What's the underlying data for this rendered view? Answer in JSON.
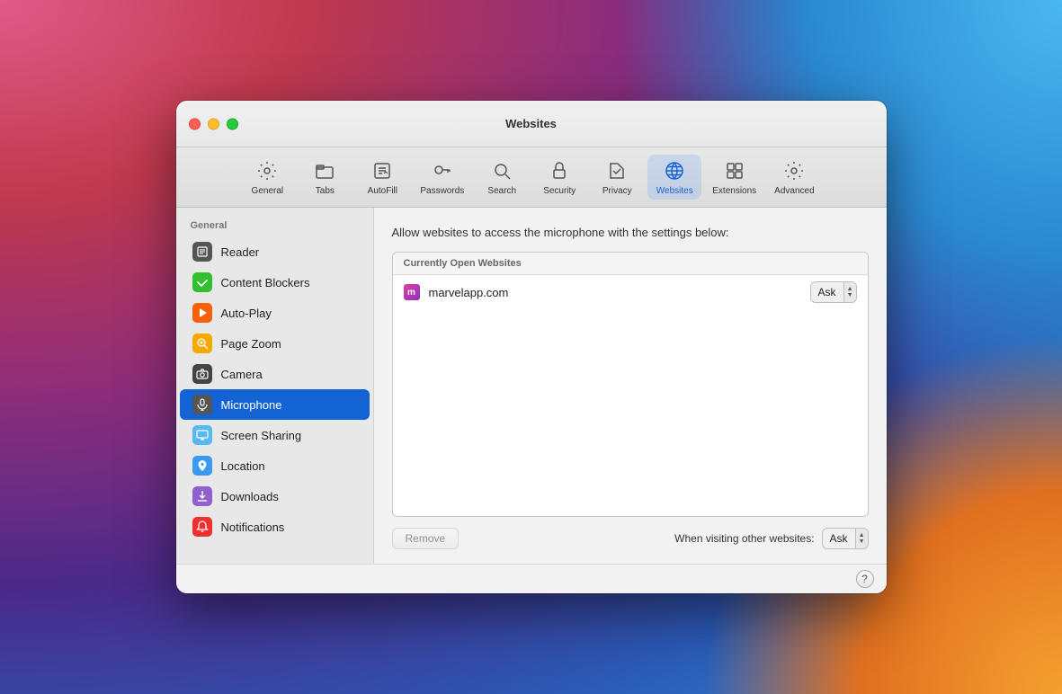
{
  "window": {
    "title": "Websites"
  },
  "trafficLights": {
    "close": "close",
    "minimize": "minimize",
    "maximize": "maximize"
  },
  "toolbar": {
    "items": [
      {
        "id": "general",
        "label": "General",
        "icon": "⚙️"
      },
      {
        "id": "tabs",
        "label": "Tabs",
        "icon": "⬜"
      },
      {
        "id": "autofill",
        "label": "AutoFill",
        "icon": "✏️"
      },
      {
        "id": "passwords",
        "label": "Passwords",
        "icon": "🔑"
      },
      {
        "id": "search",
        "label": "Search",
        "icon": "🔍"
      },
      {
        "id": "security",
        "label": "Security",
        "icon": "🔒"
      },
      {
        "id": "privacy",
        "label": "Privacy",
        "icon": "✋"
      },
      {
        "id": "websites",
        "label": "Websites",
        "icon": "🌐",
        "active": true
      },
      {
        "id": "extensions",
        "label": "Extensions",
        "icon": "🧩"
      },
      {
        "id": "advanced",
        "label": "Advanced",
        "icon": "⚙️"
      }
    ]
  },
  "sidebar": {
    "group_label": "General",
    "items": [
      {
        "id": "reader",
        "label": "Reader",
        "icon": "📄",
        "iconClass": "icon-reader",
        "active": false
      },
      {
        "id": "content-blockers",
        "label": "Content Blockers",
        "icon": "✓",
        "iconClass": "icon-content-blockers",
        "active": false
      },
      {
        "id": "auto-play",
        "label": "Auto-Play",
        "icon": "▶",
        "iconClass": "icon-autoplay",
        "active": false
      },
      {
        "id": "page-zoom",
        "label": "Page Zoom",
        "icon": "🔍",
        "iconClass": "icon-page-zoom",
        "active": false
      },
      {
        "id": "camera",
        "label": "Camera",
        "icon": "📷",
        "iconClass": "icon-camera",
        "active": false
      },
      {
        "id": "microphone",
        "label": "Microphone",
        "icon": "🎤",
        "iconClass": "icon-microphone",
        "active": true
      },
      {
        "id": "screen-sharing",
        "label": "Screen Sharing",
        "icon": "🖥",
        "iconClass": "icon-screen-sharing",
        "active": false
      },
      {
        "id": "location",
        "label": "Location",
        "icon": "➤",
        "iconClass": "icon-location",
        "active": false
      },
      {
        "id": "downloads",
        "label": "Downloads",
        "icon": "⬇",
        "iconClass": "icon-downloads",
        "active": false
      },
      {
        "id": "notifications",
        "label": "Notifications",
        "icon": "🔔",
        "iconClass": "icon-notifications",
        "active": false
      }
    ]
  },
  "detail": {
    "description": "Allow websites to access the microphone with the settings below:",
    "tableHeader": "Currently Open Websites",
    "websites": [
      {
        "name": "marvelapp.com",
        "permission": "Ask",
        "iconText": "m"
      }
    ],
    "removeButton": "Remove",
    "footerLabel": "When visiting other websites:",
    "footerPermission": "Ask",
    "helpButton": "?"
  }
}
